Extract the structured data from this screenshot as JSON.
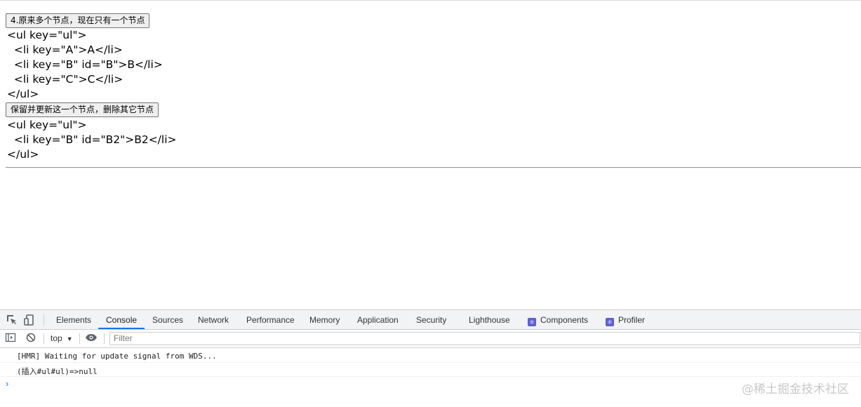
{
  "page": {
    "button1": "4.原来多个节点，现在只有一个节点",
    "code1": [
      "<ul key=\"ul\">",
      "  <li key=\"A\">A</li>",
      "  <li key=\"B\" id=\"B\">B</li>",
      "  <li key=\"C\">C</li>",
      "</ul>"
    ],
    "button2": "保留并更新这一个节点，删除其它节点",
    "code2": [
      "<ul key=\"ul\">",
      "  <li key=\"B\" id=\"B2\">B2</li>",
      "</ul>"
    ]
  },
  "devtools": {
    "tabs": [
      "Elements",
      "Console",
      "Sources",
      "Network",
      "Performance",
      "Memory",
      "Application",
      "Security",
      "Lighthouse",
      "Components",
      "Profiler"
    ],
    "active_tab": "Console",
    "context": "top",
    "filter_placeholder": "Filter",
    "messages": [
      "[HMR] Waiting for update signal from WDS...",
      "(插入#ul#ul)=>null"
    ],
    "prompt": "›"
  },
  "watermark": "@稀土掘金技术社区",
  "colors": {
    "accent": "#1a73e8",
    "badge": "#5b5fd6"
  }
}
